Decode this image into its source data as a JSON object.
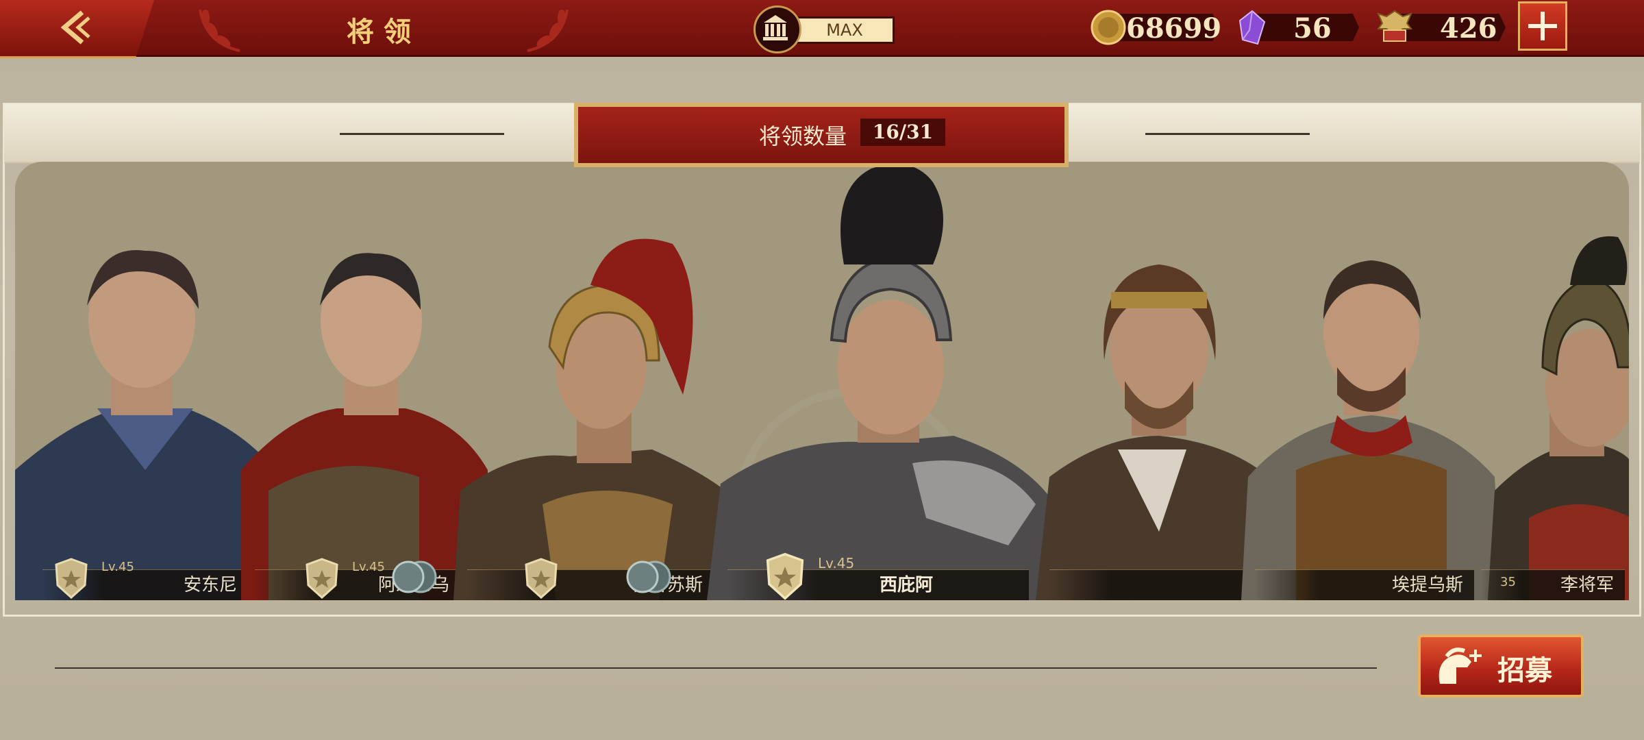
{
  "header": {
    "title": "将领",
    "level_label": "MAX",
    "resources": [
      {
        "name": "gold",
        "icon": "gold-coin-icon",
        "value": "68699"
      },
      {
        "name": "gem",
        "icon": "purple-gem-icon",
        "value": "56"
      },
      {
        "name": "spqr",
        "icon": "spqr-eagle-icon",
        "value": "426"
      }
    ],
    "add_label": "+"
  },
  "roster": {
    "count_label": "将领数量",
    "count_value": "16/31",
    "generals": [
      {
        "name": "安东尼",
        "level": "Lv.45"
      },
      {
        "name": "阿米尼乌",
        "level": "Lv.45"
      },
      {
        "name": "德鲁苏斯",
        "level": ""
      },
      {
        "name": "西庇阿",
        "level": "Lv.45"
      },
      {
        "name": "",
        "level": ""
      },
      {
        "name": "埃提乌斯",
        "level": ""
      },
      {
        "name": "李将军",
        "level": "35"
      }
    ]
  },
  "recruit": {
    "label": "招募"
  },
  "colors": {
    "accent_red": "#8e1a14",
    "gold": "#d8b068",
    "background": "#b9b19c"
  }
}
